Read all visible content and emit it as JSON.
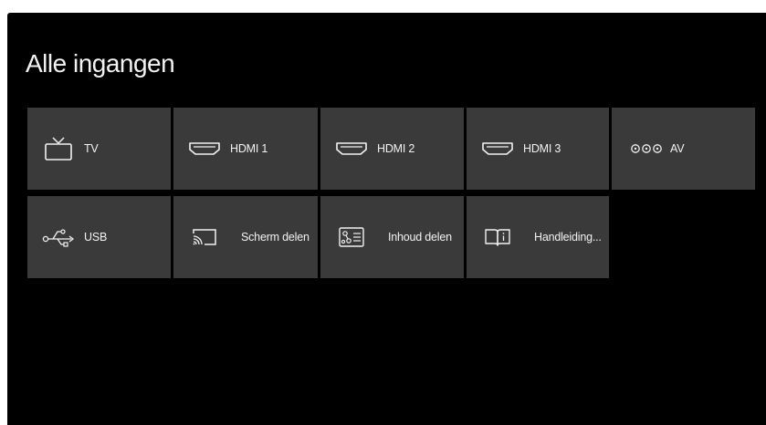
{
  "page": {
    "title": "Alle ingangen"
  },
  "colors": {
    "screen_background": "#000000",
    "tile_background": "#3a3a3a",
    "text": "#f2f2f2"
  },
  "tiles": [
    {
      "label": "TV",
      "icon": "tv-icon"
    },
    {
      "label": "HDMI 1",
      "icon": "hdmi-icon"
    },
    {
      "label": "HDMI 2",
      "icon": "hdmi-icon"
    },
    {
      "label": "HDMI 3",
      "icon": "hdmi-icon"
    },
    {
      "label": "AV",
      "icon": "av-icon"
    },
    {
      "label": "USB",
      "icon": "usb-icon"
    },
    {
      "label": "Scherm delen",
      "icon": "screen-cast-icon"
    },
    {
      "label": "Inhoud delen",
      "icon": "content-share-icon"
    },
    {
      "label": "Handleiding...",
      "icon": "manual-book-icon"
    }
  ]
}
